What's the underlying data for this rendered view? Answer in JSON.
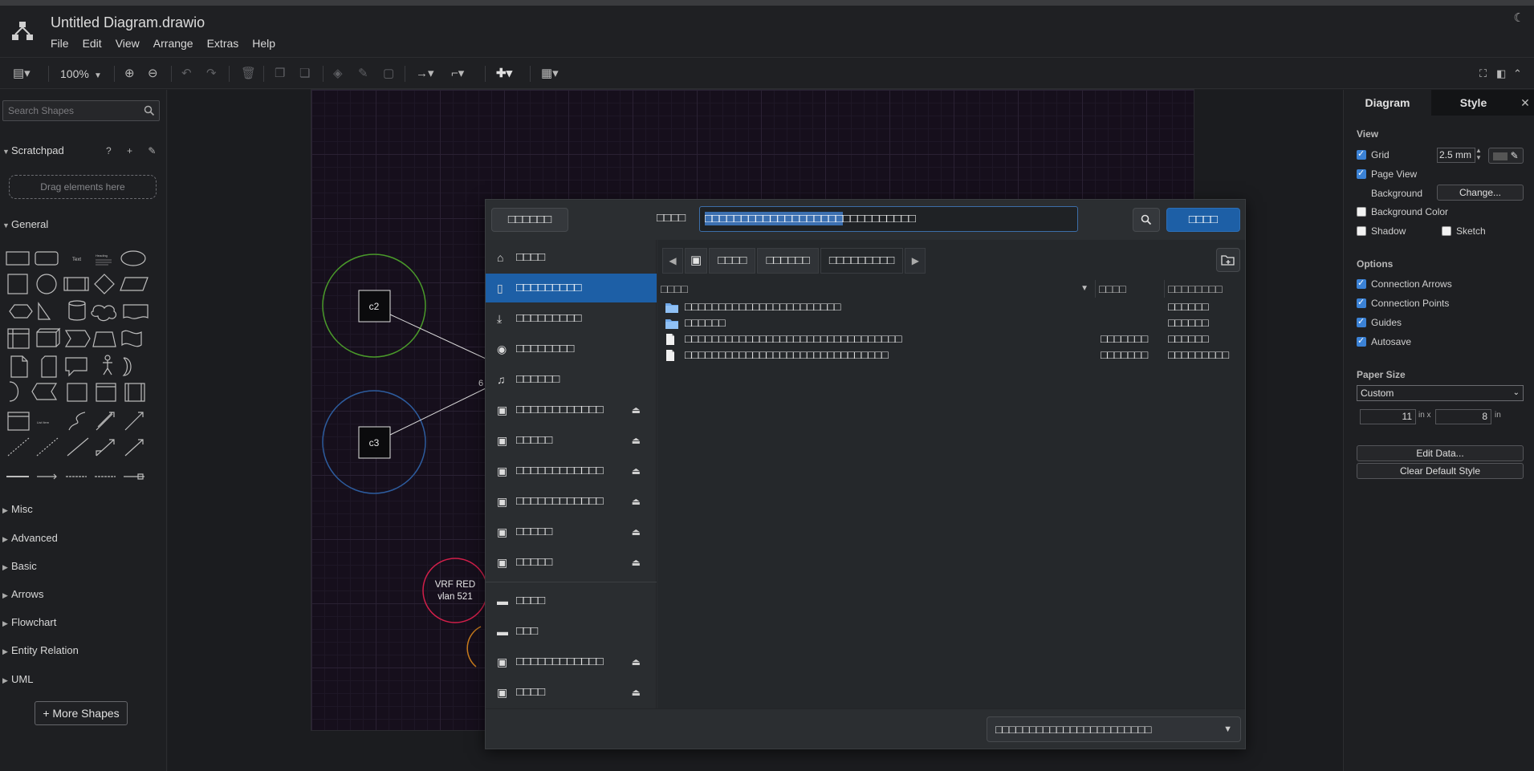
{
  "app": {
    "title": "Untitled Diagram.drawio",
    "menu": [
      "File",
      "Edit",
      "View",
      "Arrange",
      "Extras",
      "Help"
    ]
  },
  "toolbar": {
    "zoom": "100%"
  },
  "left_panel": {
    "search_placeholder": "Search Shapes",
    "scratchpad_label": "Scratchpad",
    "scratchpad_tools": "? + ✎ ✕",
    "dropzone_text": "Drag elements here",
    "general_label": "General",
    "sections": [
      "Misc",
      "Advanced",
      "Basic",
      "Arrows",
      "Flowchart",
      "Entity Relation",
      "UML"
    ],
    "more_shapes": "More Shapes"
  },
  "diagram": {
    "nodes": [
      {
        "label": "c2",
        "ring_color": "#4a9a2a"
      },
      {
        "label": "c3",
        "ring_color": "#2d5c9e"
      }
    ],
    "vrf_label_1": "VRF RED",
    "vrf_label_2": "vlan 521",
    "vrf_color": "#d21f4a",
    "partial_label": "6"
  },
  "right_panel": {
    "tab_diagram": "Diagram",
    "tab_style": "Style",
    "view_head": "View",
    "grid_label": "Grid",
    "grid_value": "2.5 mm",
    "page_view_label": "Page View",
    "background_label": "Background",
    "change_button": "Change...",
    "background_color_label": "Background Color",
    "shadow_label": "Shadow",
    "sketch_label": "Sketch",
    "options_head": "Options",
    "options": [
      "Connection Arrows",
      "Connection Points",
      "Guides",
      "Autosave"
    ],
    "paper_size_head": "Paper Size",
    "paper_size_value": "Custom",
    "width_value": "11",
    "height_value": "8",
    "unit_in": "in",
    "unit_x": "in x",
    "edit_data_button": "Edit Data...",
    "clear_style_button": "Clear Default Style"
  },
  "dialog": {
    "cancel_button": "□□□□□□",
    "name_label": "□□□□",
    "name_selected": "□□□□□□□□□□□□□□□□□□□",
    "name_rest": "□□□□□□□□□□",
    "save_button": "□□□□",
    "places": [
      {
        "label": "□□□□",
        "icon": "⌂",
        "eject": false,
        "active": false
      },
      {
        "label": "□□□□□□□□□",
        "icon": "▯",
        "eject": false,
        "active": true
      },
      {
        "label": "□□□□□□□□□",
        "icon": "⤓",
        "eject": false,
        "active": false
      },
      {
        "label": "□□□□□□□□",
        "icon": "◉",
        "eject": false,
        "active": false
      },
      {
        "label": "□□□□□□",
        "icon": "♫",
        "eject": false,
        "active": false
      },
      {
        "label": "□□□□□□□□□□□□",
        "icon": "▣",
        "eject": true,
        "active": false
      },
      {
        "label": "□□□□□",
        "icon": "▣",
        "eject": true,
        "active": false
      },
      {
        "label": "□□□□□□□□□□□□",
        "icon": "▣",
        "eject": true,
        "active": false
      },
      {
        "label": "□□□□□□□□□□□□",
        "icon": "▣",
        "eject": true,
        "active": false
      },
      {
        "label": "□□□□□",
        "icon": "▣",
        "eject": true,
        "active": false
      },
      {
        "label": "□□□□□",
        "icon": "▣",
        "eject": true,
        "active": false
      }
    ],
    "devices": [
      {
        "label": "□□□□",
        "icon": "▬",
        "eject": false
      },
      {
        "label": "□□□",
        "icon": "▬",
        "eject": false
      },
      {
        "label": "□□□□□□□□□□□□",
        "icon": "▣",
        "eject": true
      },
      {
        "label": "□□□□",
        "icon": "▣",
        "eject": true
      }
    ],
    "crumbs": [
      "□□□□",
      "□□□□□□",
      "□□□□□□□□□"
    ],
    "columns": {
      "name": "□□□□",
      "size": "□□□□",
      "modified": "□□□□□□□□"
    },
    "files": [
      {
        "type": "folder",
        "name": "□□□□□□□□□□□□□□□□□□□□□□□",
        "size": "",
        "modified": "□□□□□□"
      },
      {
        "type": "folder",
        "name": "□□□□□□",
        "size": "",
        "modified": "□□□□□□"
      },
      {
        "type": "file",
        "name": "□□□□□□□□□□□□□□□□□□□□□□□□□□□□□□□□",
        "size": "□□□□□□□",
        "modified": "□□□□□□"
      },
      {
        "type": "file",
        "name": "□□□□□□□□□□□□□□□□□□□□□□□□□□□□□□",
        "size": "□□□□□□□",
        "modified": "□□□□□□□□□"
      }
    ],
    "filter": "□□□□□□□□□□□□□□□□□□□□□□□"
  }
}
